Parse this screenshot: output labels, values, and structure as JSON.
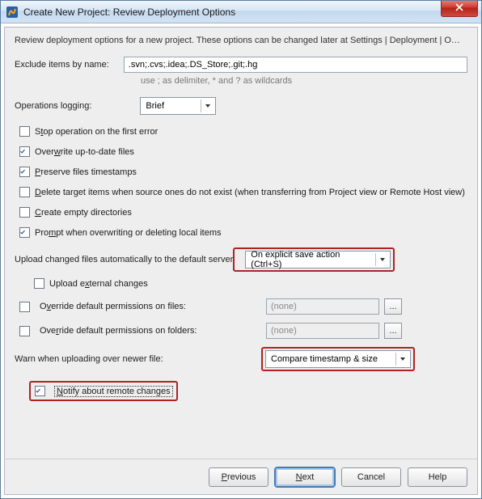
{
  "window": {
    "title": "Create New Project: Review Deployment Options"
  },
  "description": "Review deployment options for a new project. These options can be changed later at Settings | Deployment | O…",
  "exclude": {
    "label": "Exclude items by name:",
    "value": ".svn;.cvs;.idea;.DS_Store;.git;.hg",
    "hint": "use ; as delimiter, * and ? as wildcards"
  },
  "oplog": {
    "label": "Operations logging:",
    "value": "Brief"
  },
  "checkboxes": {
    "stop_first_error": {
      "pre": "S",
      "u": "t",
      "post": "op operation on the first error",
      "checked": false
    },
    "overwrite_uptodate": {
      "pre": "Over",
      "u": "w",
      "post": "rite up-to-date files",
      "checked": true
    },
    "preserve_ts": {
      "pre": "",
      "u": "P",
      "post": "reserve files timestamps",
      "checked": true
    },
    "delete_target": {
      "pre": "",
      "u": "D",
      "post": "elete target items when source ones do not exist (when transferring from Project view or Remote Host view)",
      "checked": false
    },
    "create_empty": {
      "pre": "",
      "u": "C",
      "post": "reate empty directories",
      "checked": false
    },
    "prompt_overwrite": {
      "pre": "Pro",
      "u": "m",
      "post": "pt when overwriting or deleting local items",
      "checked": true
    },
    "upload_external": {
      "pre": "Upload e",
      "u": "x",
      "post": "ternal changes",
      "checked": false
    },
    "override_files": {
      "pre": "O",
      "u": "v",
      "post": "erride default permissions on files:",
      "checked": false
    },
    "override_folders": {
      "pre": "Ove",
      "u": "r",
      "post": "ride default permissions on folders:",
      "checked": false
    },
    "notify_remote": {
      "pre": "",
      "u": "N",
      "post": "otify about remote changes",
      "checked": true
    }
  },
  "upload_auto": {
    "label": "Upload changed files automatically to the default server",
    "value": "On explicit save action (Ctrl+S)"
  },
  "perms": {
    "files_placeholder": "(none)",
    "folders_placeholder": "(none)",
    "dots": "..."
  },
  "warn": {
    "label_pre": "Warn when uploading over ",
    "label_u": "n",
    "label_post": "ewer file:",
    "value": "Compare timestamp & size"
  },
  "buttons": {
    "previous": {
      "u": "P",
      "rest": "revious"
    },
    "next": {
      "u": "N",
      "rest": "ext"
    },
    "cancel": "Cancel",
    "help": "Help"
  }
}
